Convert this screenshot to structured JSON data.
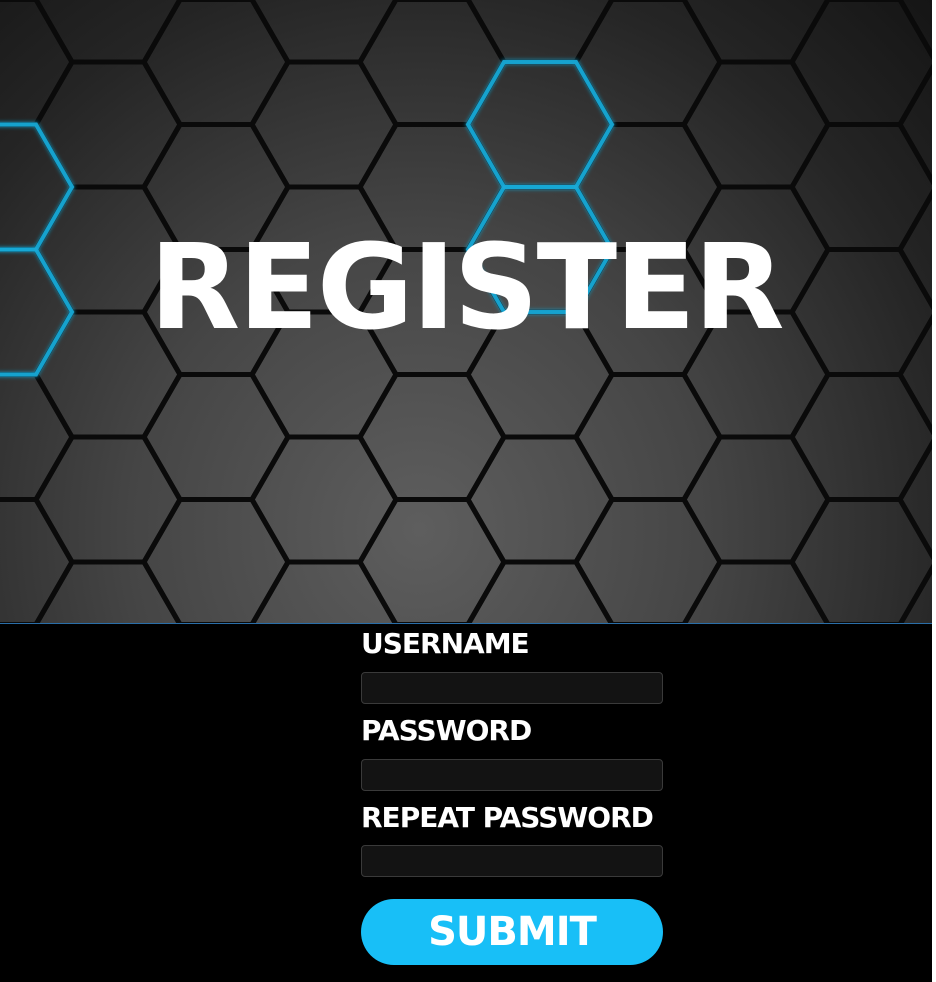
{
  "header": {
    "title": "REGISTER"
  },
  "form": {
    "username_label": "USERNAME",
    "password_label": "PASSWORD",
    "repeat_password_label": "REPEAT PASSWORD",
    "username_value": "",
    "password_value": "",
    "repeat_password_value": "",
    "submit_label": "SUBMIT"
  },
  "colors": {
    "accent": "#18bff7",
    "hex_glow": "#1aa9d6",
    "background": "#000000",
    "input_bg": "#131313"
  },
  "background_image": {
    "description_icon": "hexagon-pattern"
  }
}
